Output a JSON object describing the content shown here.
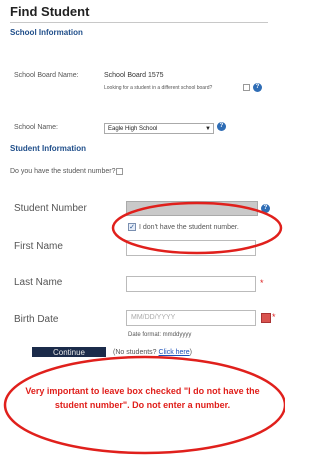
{
  "header": {
    "title": "Find Student"
  },
  "school_info": {
    "section_title": "School Information",
    "board_label": "School Board Name:",
    "board_value": "School Board 1575",
    "board_note": "Looking for a student in a different school board?",
    "school_label": "School Name:",
    "school_value": "Eagle High School"
  },
  "student_info": {
    "section_title": "Student Information",
    "have_number_question": "Do you have the student number?",
    "student_number_label": "Student Number",
    "dont_have_label": "I don't have the student number.",
    "first_name_label": "First Name",
    "last_name_label": "Last Name",
    "birth_date_label": "Birth Date",
    "birth_date_placeholder": "MM/DD/YYYY",
    "date_format_hint": "Date format: mmddyyyy",
    "required_mark": "*"
  },
  "actions": {
    "continue_label": "Continue",
    "no_students_prefix": "(No students? ",
    "click_here_label": "Click here",
    "no_students_suffix": ")"
  },
  "annotation": {
    "line1": "Very important to leave box checked \"I do not have the",
    "line2": "student number\".  Do not enter a number.",
    "color": "#e0201c"
  },
  "icons": {
    "help": "?",
    "checkmark": "✓",
    "dropdown": "▼"
  }
}
